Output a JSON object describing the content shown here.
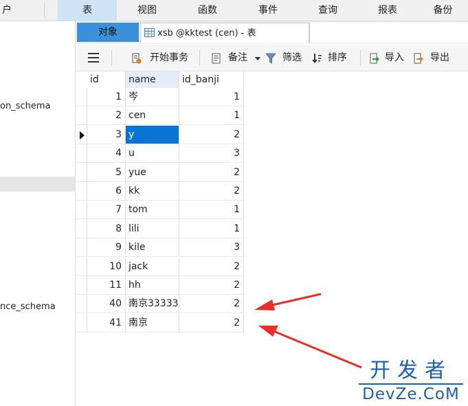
{
  "menubar": {
    "items": [
      {
        "label": "户"
      },
      {
        "label": "表"
      },
      {
        "label": "视图"
      },
      {
        "label": "函数"
      },
      {
        "label": "事件"
      },
      {
        "label": "查询"
      },
      {
        "label": "报表"
      },
      {
        "label": "备份"
      }
    ],
    "active": "表"
  },
  "leftpane": {
    "items": [
      {
        "label": "on_schema"
      },
      {
        "label": "nce_schema"
      }
    ]
  },
  "tabs": {
    "objects_label": "对象",
    "table_label": "xsb @kktest (cen) - 表"
  },
  "toolbar": {
    "begin_transaction": "开始事务",
    "note": "备注",
    "filter": "筛选",
    "sort": "排序",
    "import": "导入",
    "export": "导出"
  },
  "grid": {
    "columns": [
      {
        "label": "id"
      },
      {
        "label": "name"
      },
      {
        "label": "id_banji"
      }
    ],
    "rows": [
      {
        "id": "1",
        "name": "岑",
        "id_banji": "1"
      },
      {
        "id": "2",
        "name": "cen",
        "id_banji": "1"
      },
      {
        "id": "3",
        "name": "y",
        "id_banji": "2"
      },
      {
        "id": "4",
        "name": "u",
        "id_banji": "3"
      },
      {
        "id": "5",
        "name": "yue",
        "id_banji": "2"
      },
      {
        "id": "6",
        "name": "kk",
        "id_banji": "2"
      },
      {
        "id": "7",
        "name": "tom",
        "id_banji": "1"
      },
      {
        "id": "8",
        "name": "lili",
        "id_banji": "1"
      },
      {
        "id": "9",
        "name": "kile",
        "id_banji": "3"
      },
      {
        "id": "10",
        "name": "jack",
        "id_banji": "2"
      },
      {
        "id": "11",
        "name": "hh",
        "id_banji": "2"
      },
      {
        "id": "40",
        "name": "南京33333",
        "id_banji": "2"
      },
      {
        "id": "41",
        "name": "南京",
        "id_banji": "2"
      }
    ]
  },
  "watermark": {
    "cn": "开发者",
    "en": "DevZe.CoM"
  },
  "colors": {
    "selection": "#0a74d6",
    "objects_tab": "#3c8fd9",
    "annotation_arrow": "#e8302a",
    "watermark": "#1f5ea8"
  }
}
